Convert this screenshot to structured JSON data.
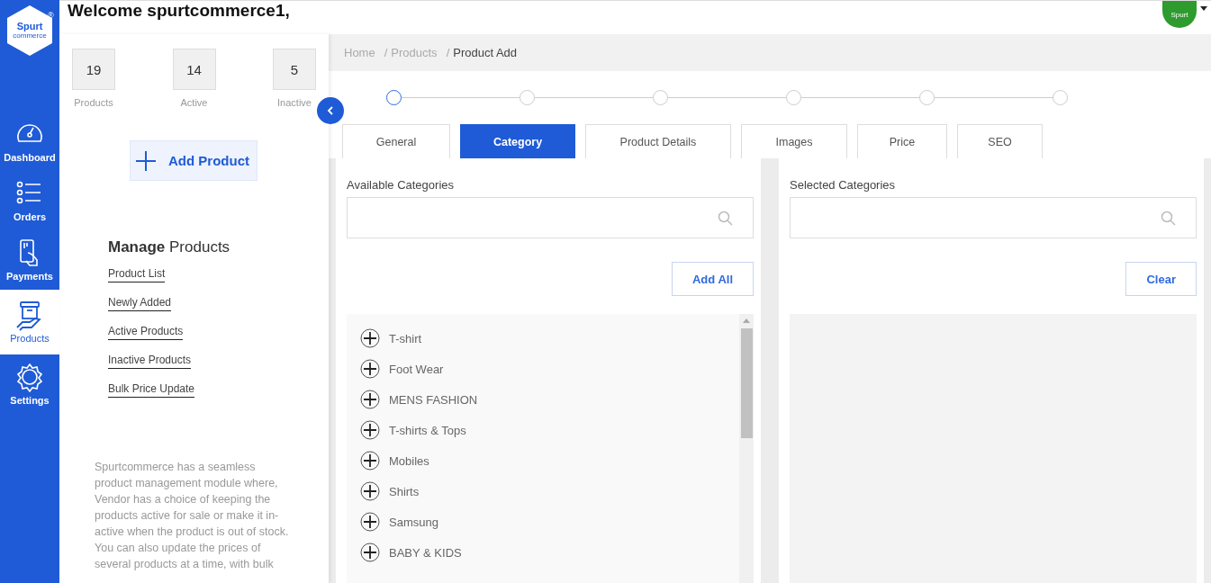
{
  "sidebar": {
    "logo": {
      "text": "Spurt",
      "subtext": "commerce",
      "mark": "®"
    },
    "items": [
      {
        "label": "Dashboard",
        "selected": false
      },
      {
        "label": "Orders",
        "selected": false
      },
      {
        "label": "Payments",
        "selected": false
      },
      {
        "label": "Products",
        "selected": true
      },
      {
        "label": "Settings",
        "selected": false
      }
    ]
  },
  "header": {
    "welcome": "Welcome spurtcommerce1,",
    "avatar_text": "Spurt"
  },
  "stats": [
    {
      "value": "19",
      "label": "Products"
    },
    {
      "value": "14",
      "label": "Active"
    },
    {
      "value": "5",
      "label": "Inactive"
    }
  ],
  "add_product": "Add Product",
  "manage": {
    "heading": "**Manage** Products",
    "links": [
      "Product List",
      "Newly Added",
      "Active Products",
      "Inactive Products",
      "Bulk Price Update"
    ]
  },
  "description": "Spurtcommerce has a seamless product management module where, Vendor has a choice of keeping the products active for sale or make it in-active when the product is out of stock. You can also update the prices of several products at a time, with bulk",
  "breadcrumb": [
    {
      "label": "Home",
      "current": false
    },
    {
      "separator": "/",
      "label": "Products",
      "current": false
    },
    {
      "separator": "/",
      "label": "Product Add",
      "current": true
    }
  ],
  "steps": [
    {
      "selected": true
    },
    {
      "selected": false
    },
    {
      "selected": false
    },
    {
      "selected": false
    },
    {
      "selected": false
    },
    {
      "selected": false
    }
  ],
  "tabs": [
    {
      "label": "General",
      "selected": false
    },
    {
      "label": "Category",
      "selected": true
    },
    {
      "label": "Product Details",
      "selected": false
    },
    {
      "label": "Images",
      "selected": false
    },
    {
      "label": "Price",
      "selected": false
    },
    {
      "label": "SEO",
      "selected": false
    }
  ],
  "available": {
    "title": "Available Categories",
    "button": "Add All",
    "items": [
      "T-shirt",
      "Foot Wear",
      "MENS FASHION",
      "T-shirts & Tops",
      "Mobiles",
      "Shirts",
      "Samsung",
      "BABY & KIDS"
    ]
  },
  "chosen": {
    "title": "Selected Categories",
    "button": "Clear"
  }
}
